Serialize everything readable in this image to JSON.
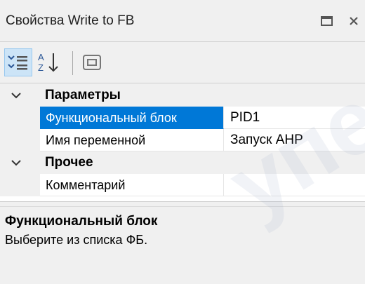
{
  "window": {
    "title": "Свойства Write to FB",
    "restore_icon": "restore-window-icon",
    "close_icon": "close-icon"
  },
  "toolbar": {
    "categorized_icon": "categorized-view-icon",
    "sort_icon": "sort-alphabetical-icon",
    "sort_letters_top": "A",
    "sort_letters_bottom": "Z",
    "pages_icon": "property-pages-icon"
  },
  "grid": {
    "categories": [
      {
        "label": "Параметры",
        "expanded": true,
        "properties": [
          {
            "name": "Функциональный блок",
            "value": "PID1",
            "selected": true,
            "has_dropdown": true
          },
          {
            "name": "Имя переменной",
            "value": "Запуск АНР",
            "selected": false,
            "has_dropdown": false
          }
        ]
      },
      {
        "label": "Прочее",
        "expanded": true,
        "properties": [
          {
            "name": "Комментарий",
            "value": "",
            "selected": false,
            "has_dropdown": false
          }
        ]
      }
    ]
  },
  "description": {
    "title": "Функциональный блок",
    "text": "Выберите из списка ФБ."
  },
  "watermark": {
    "text": "упер"
  },
  "colors": {
    "selection": "#0078d7",
    "panel_bg": "#f0f0f0",
    "grid_bg": "#ffffff",
    "toolbar_active": "#cce4f7"
  }
}
